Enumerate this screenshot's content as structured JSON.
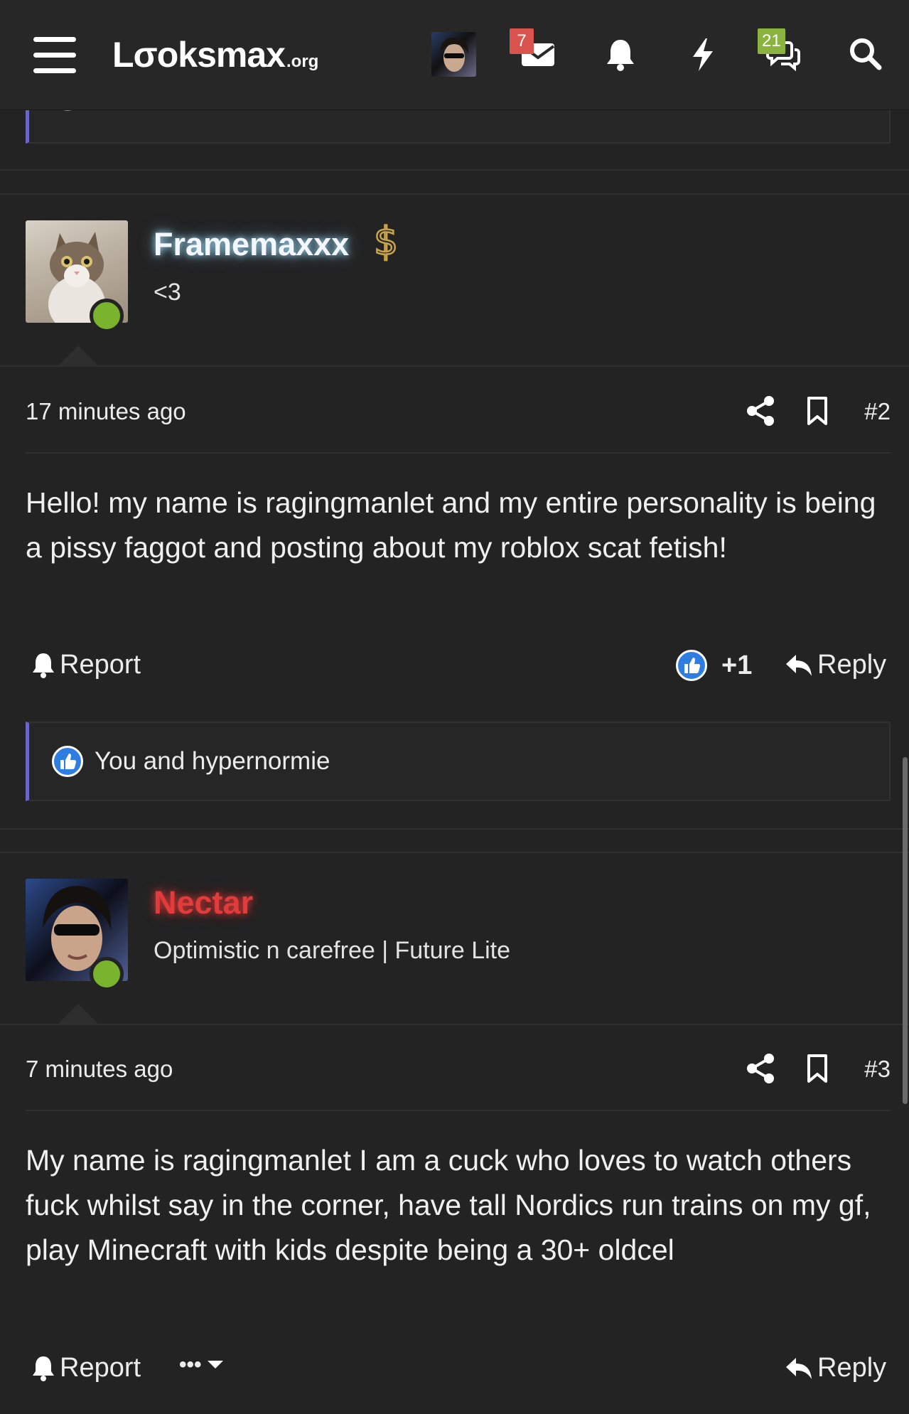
{
  "header": {
    "logo_main": "Lσoksmax",
    "logo_tld": ".org",
    "inbox_badge": "7",
    "chat_badge": "21",
    "icons": [
      "menu-icon",
      "avatar",
      "inbox-icon",
      "bell-icon",
      "bolt-icon",
      "chat-icon",
      "search-icon"
    ]
  },
  "posts": [
    {
      "username": "Framemaxxx",
      "user_title": "<3",
      "time": "17 minutes ago",
      "number": "#2",
      "message": "Hello! my name is ragingmanlet and my entire personality is being a pissy faggot and posting about my roblox scat fetish!",
      "report_label": "Report",
      "reaction_score": "+1",
      "reply_label": "Reply",
      "reactions_text": "You and hypernormie",
      "status_color": "#7ab32e"
    },
    {
      "username": "Nectar",
      "user_title": "Optimistic n carefree | Future Lite",
      "time": "7 minutes ago",
      "number": "#3",
      "message": "My name is ragingmanlet I am a cuck who loves to watch others fuck whilst say in the corner, have tall Nordics run trains on my gf, play Minecraft with kids despite being a 30+ oldcel",
      "report_label": "Report",
      "more_label": "•••",
      "reply_label": "Reply",
      "status_color": "#7ab32e"
    }
  ],
  "colors": {
    "background": "#232323",
    "accent_bar": "#6b67c9",
    "like_blue": "#2f7de1",
    "badge_red": "#d9534f",
    "badge_green": "#8ab33f",
    "nectar_red": "#e03c3c"
  }
}
